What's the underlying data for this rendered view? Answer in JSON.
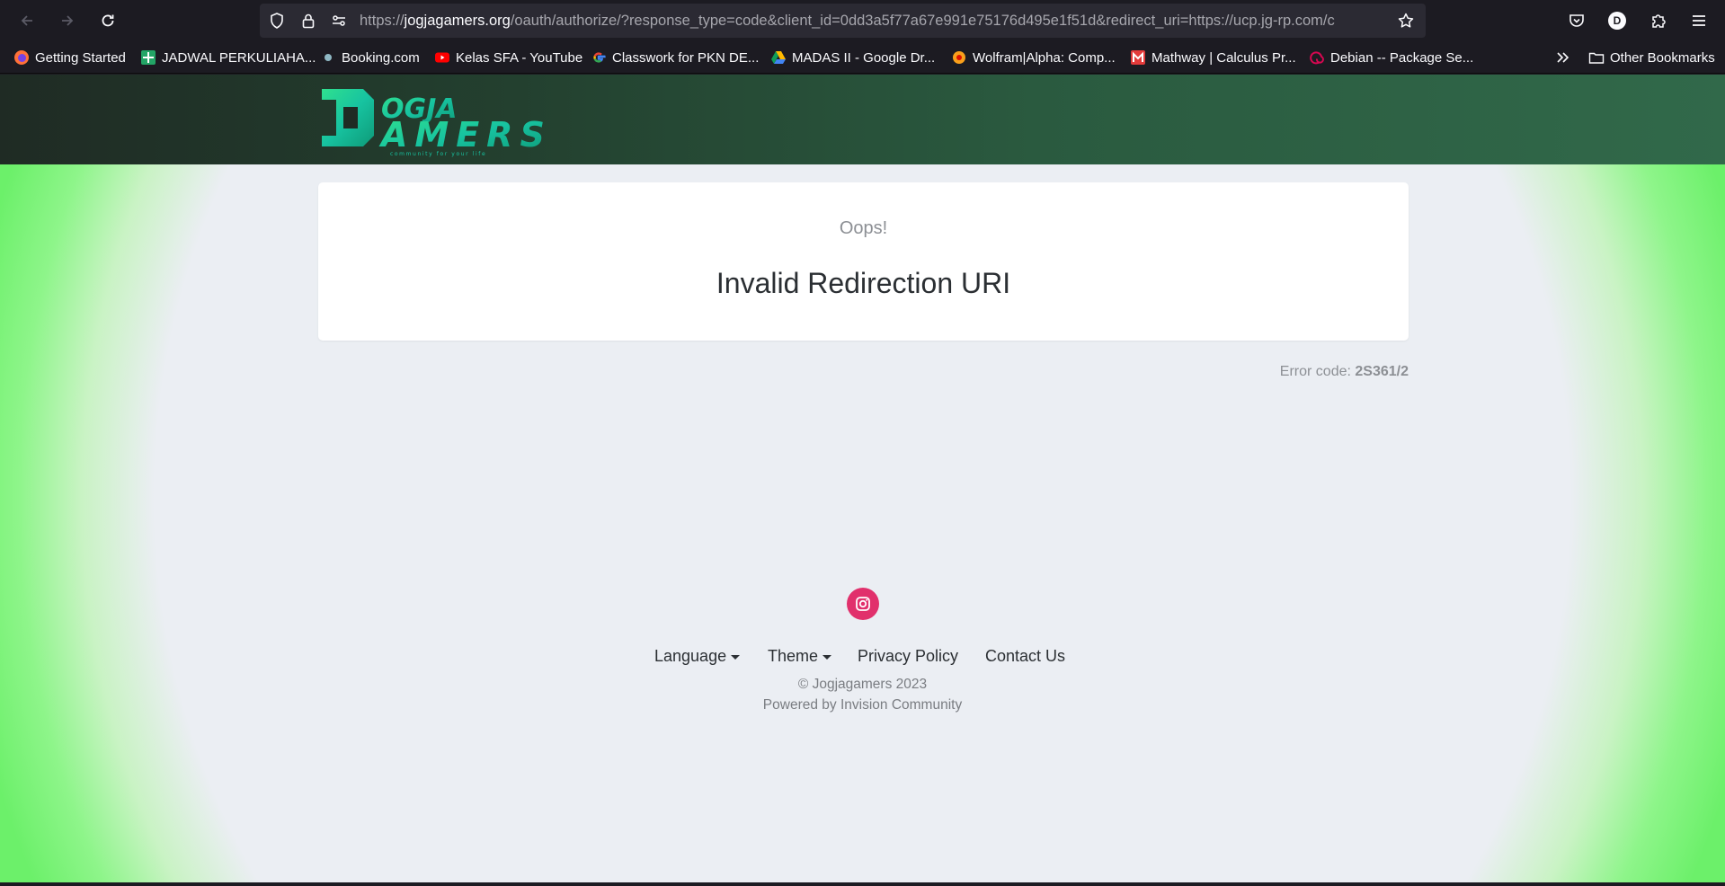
{
  "browser": {
    "url_prefix": "https://",
    "url_host": "jogjagamers.org",
    "url_rest": "/oauth/authorize/?response_type=code&client_id=0dd3a5f77a67e991e75176d495e1f51d&redirect_uri=https://ucp.jg-rp.com/c",
    "profile_initial": "D",
    "icons": {
      "back": "arrow-left-icon",
      "forward": "arrow-right-icon",
      "reload": "reload-icon",
      "tracking": "shield-icon",
      "lock": "lock-icon",
      "permissions": "sliders-icon",
      "bookmark_star": "star-icon",
      "pocket": "pocket-icon",
      "extensions": "puzzle-icon",
      "menu": "hamburger-icon"
    },
    "bookmarks": [
      {
        "label": "Getting Started",
        "icon": "firefox-icon"
      },
      {
        "label": "JADWAL PERKULIAHA...",
        "icon": "sheets-icon"
      },
      {
        "label": "Booking.com",
        "icon": "booking-icon"
      },
      {
        "label": "Kelas SFA - YouTube",
        "icon": "youtube-icon"
      },
      {
        "label": "Classwork for PKN DE...",
        "icon": "google-icon"
      },
      {
        "label": "MADAS II - Google Dr...",
        "icon": "google-drive-icon"
      },
      {
        "label": "Wolfram|Alpha: Comp...",
        "icon": "wolfram-icon"
      },
      {
        "label": "Mathway | Calculus Pr...",
        "icon": "mathway-icon"
      },
      {
        "label": "Debian -- Package Se...",
        "icon": "debian-icon"
      }
    ],
    "overflow_icon": "chevrons-right-icon",
    "other_bookmarks": "Other Bookmarks"
  },
  "site": {
    "logo_text": "JOGJA GAMERS",
    "logo_tagline": "community for your life"
  },
  "error": {
    "oops": "Oops!",
    "title": "Invalid Redirection URI",
    "code_label": "Error code:",
    "code_value": "2S361/2"
  },
  "footer": {
    "social_icon": "instagram-icon",
    "language": "Language",
    "theme": "Theme",
    "privacy": "Privacy Policy",
    "contact": "Contact Us",
    "copyright": "© Jogjagamers 2023",
    "powered": "Powered by Invision Community"
  },
  "colors": {
    "chrome_bg": "#1c1b22",
    "urlbar_bg": "#2b2a33",
    "header_start": "#1f2b24",
    "header_end": "#31694a",
    "page_bg": "#ebeef3",
    "edge_green": "#6cf06a",
    "logo_green": "#1fd18a",
    "instagram": "#e1306c"
  }
}
